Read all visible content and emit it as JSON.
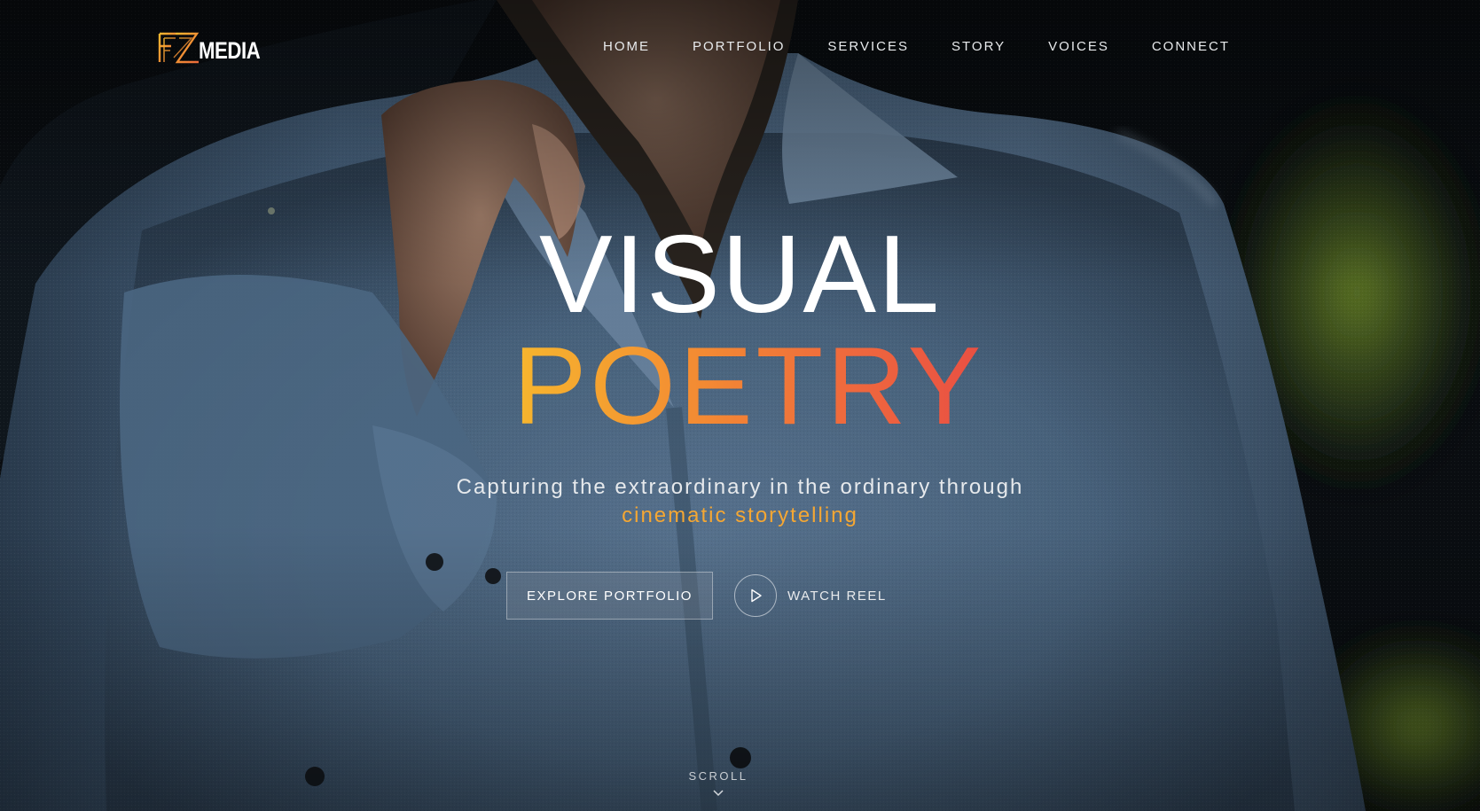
{
  "brand": {
    "logo_mark": "FZ",
    "logo_text": "MEDIA",
    "accent_orange": "#f5a733",
    "accent_red": "#e94f43"
  },
  "nav": {
    "items": [
      {
        "label": "HOME"
      },
      {
        "label": "PORTFOLIO"
      },
      {
        "label": "SERVICES"
      },
      {
        "label": "STORY"
      },
      {
        "label": "VOICES"
      },
      {
        "label": "CONNECT"
      }
    ]
  },
  "hero": {
    "headline_line1": "VISUAL",
    "headline_line2": "POETRY",
    "tagline": "Capturing the extraordinary in the ordinary through",
    "tagline_accent": "cinematic storytelling",
    "primary_cta": "EXPLORE PORTFOLIO",
    "secondary_cta": "WATCH REEL",
    "secondary_cta_icon": "play-icon",
    "scroll_label": "SCROLL",
    "scroll_icon": "chevron-down-icon"
  }
}
